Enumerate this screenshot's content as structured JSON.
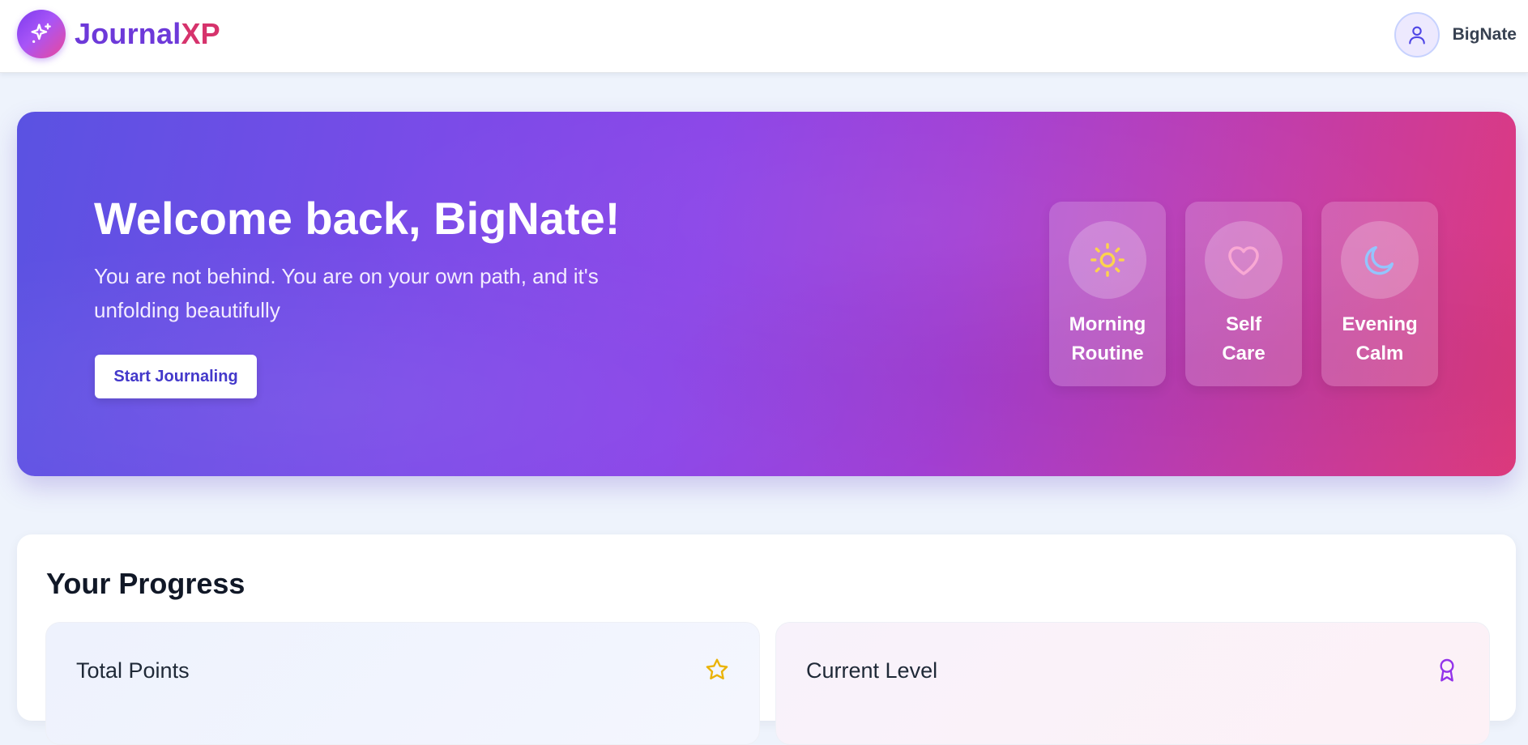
{
  "header": {
    "brand_part1": "Journal",
    "brand_part2": "XP",
    "logo_icon": "sparkles-icon",
    "user_icon": "user-icon",
    "username": "BigNate"
  },
  "hero": {
    "title": "Welcome back, BigNate!",
    "subtitle": "You are not behind. You are on your own path, and it's unfolding beautifully",
    "cta_label": "Start Journaling",
    "routines": [
      {
        "line1": "Morning",
        "line2": "Routine",
        "icon": "sun-icon",
        "icon_color": "#fcd34d"
      },
      {
        "line1": "Self",
        "line2": "Care",
        "icon": "heart-icon",
        "icon_color": "#f9a8d4"
      },
      {
        "line1": "Evening",
        "line2": "Calm",
        "icon": "moon-icon",
        "icon_color": "#93c5fd"
      }
    ]
  },
  "progress": {
    "title": "Your Progress",
    "cards": [
      {
        "label": "Total Points",
        "icon": "star-icon",
        "icon_color": "#eab308"
      },
      {
        "label": "Current Level",
        "icon": "award-icon",
        "icon_color": "#9333ea"
      }
    ]
  },
  "colors": {
    "brand_purple": "#6d39d9",
    "brand_pink": "#d6336c",
    "hero_start": "#5a52e2",
    "hero_end": "#de3a7d",
    "cta_text": "#4338ca"
  }
}
